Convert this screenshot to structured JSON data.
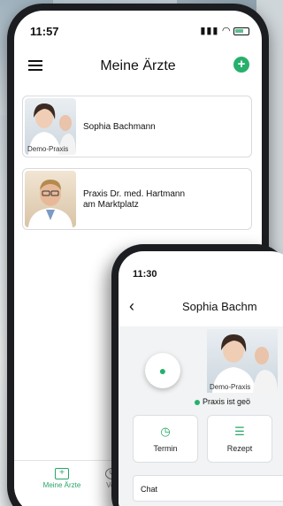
{
  "phone1": {
    "status_time": "11:57",
    "title": "Meine Ärzte",
    "doctors": [
      {
        "name": "Sophia Bachmann",
        "photo_label": "Demo-Praxis"
      },
      {
        "name_line1": "Praxis Dr. med. Hartmann",
        "name_line2": "am Marktplatz"
      }
    ],
    "nav": {
      "item1": "Meine Ärzte",
      "item2": "Verl"
    }
  },
  "phone2": {
    "status_time": "11:30",
    "title": "Sophia Bachm",
    "photo_label": "Demo-Praxis",
    "status_text": "Praxis ist geö",
    "tiles": [
      "Termin",
      "Rezept"
    ],
    "chat_label": "Chat"
  },
  "colors": {
    "accent": "#27b06c"
  }
}
